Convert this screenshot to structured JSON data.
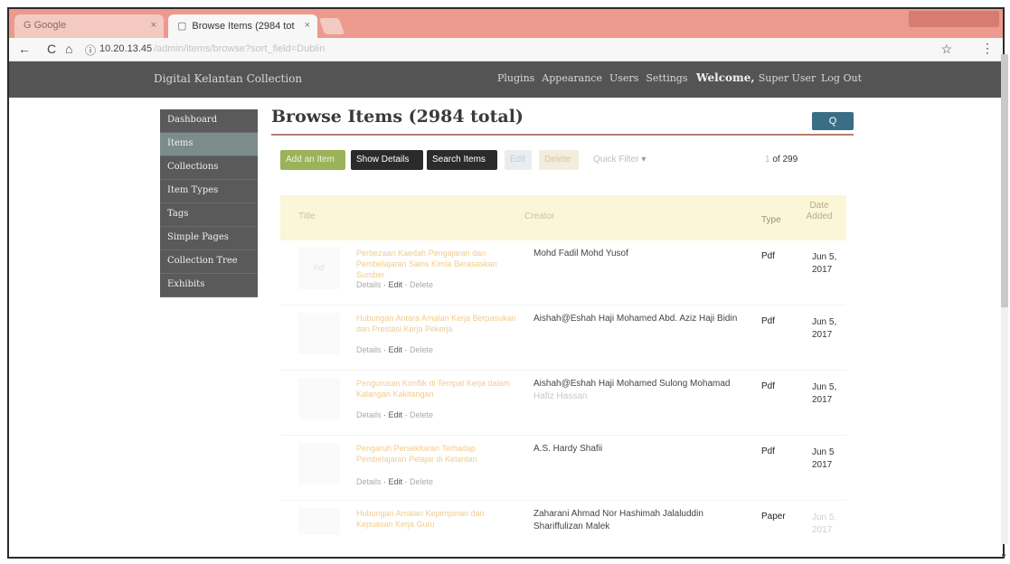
{
  "browser": {
    "tabs": [
      {
        "label": "G Google"
      },
      {
        "label": "Browse Items (2984 tot"
      }
    ],
    "url": "10.20.13.45",
    "url_rest": "/admin/items/browse?sort_field=Dublin"
  },
  "header": {
    "site_title": "Digital Kelantan Collection",
    "nav": [
      "Plugins",
      "Appearance",
      "Users",
      "Settings"
    ],
    "welcome": "Welcome,",
    "user": "Super User",
    "logout": "Log Out"
  },
  "sidebar": {
    "items": [
      {
        "label": "Dashboard"
      },
      {
        "label": "Items"
      },
      {
        "label": "Collections"
      },
      {
        "label": "Item Types"
      },
      {
        "label": "Tags"
      },
      {
        "label": "Simple Pages"
      },
      {
        "label": "Collection Tree"
      },
      {
        "label": "Exhibits"
      }
    ]
  },
  "main": {
    "title": "Browse Items (2984 total)",
    "search_label": "Q",
    "toolbar": {
      "add": "Add an Item",
      "show_details": "Show Details",
      "search": "Search Items",
      "edit": "Edit",
      "delete": "Delete",
      "quick_filter": "Quick Filter"
    },
    "pagination": {
      "page": "1",
      "total": "of 299"
    }
  },
  "table": {
    "columns": {
      "title": "Title",
      "creator": "Creator",
      "type": "Type",
      "date": "Date Added"
    },
    "rows": [
      {
        "thumb": "Pdf",
        "title": "Perbezaan Kaedah Pengajaran dan Pembelajaran Sains Kimia Berasaskan Sumber",
        "creator": "Mohd Fadil Mohd Yusof",
        "creator_extra": "",
        "type": "Pdf",
        "date_month": "Jun 5,",
        "date_year": "2017"
      },
      {
        "thumb": "",
        "title": "Hubungan Antara Amalan Kerja Berpasukan dan Prestasi Kerja Pekerja",
        "creator": "Aishah@Eshah Haji Mohamed Abd. Aziz Haji Bidin",
        "creator_extra": "",
        "type": "Pdf",
        "date_month": "Jun 5,",
        "date_year": "2017"
      },
      {
        "thumb": "",
        "title": "Pengurusan Konflik di Tempat Kerja dalam Kalangan Kakitangan",
        "creator": "Aishah@Eshah Haji Mohamed Sulong Mohamad",
        "creator_extra": "Hafiz Hassan",
        "type": "Pdf",
        "date_month": "Jun 5,",
        "date_year": "2017"
      },
      {
        "thumb": "",
        "title": "Pengaruh Persekitaran Terhadap Pembelajaran Pelajar di Kelantan",
        "creator": "A.S. Hardy Shafii",
        "creator_extra": "",
        "type": "Pdf",
        "date_month": "Jun 5",
        "date_year": "2017"
      },
      {
        "thumb": "",
        "title": "Hubungan Amalan Kepimpinan dan Kepuasan Kerja Guru",
        "creator": "Zaharani Ahmad Nor Hashimah Jalaluddin",
        "creator_extra": "Shariffulizan Malek",
        "type": "Paper",
        "date_month": "Jun 5,",
        "date_year": "2017"
      }
    ],
    "actions": {
      "details": "Details",
      "edit": "Edit",
      "delete": "Delete"
    }
  }
}
